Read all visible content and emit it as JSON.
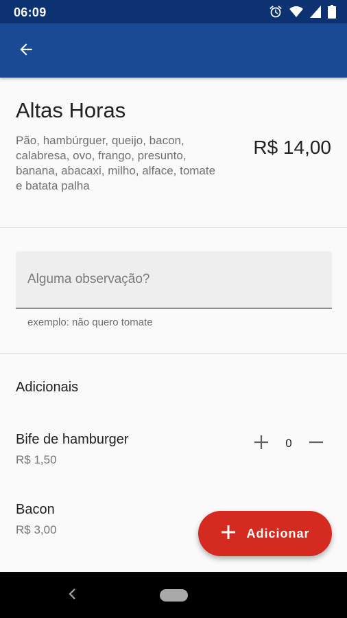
{
  "status_bar": {
    "time": "06:09",
    "icons": [
      "alarm-icon",
      "wifi-icon",
      "signal-icon",
      "battery-icon"
    ]
  },
  "app_bar": {
    "back_icon": "arrow-back-icon",
    "color": "#1a4a94"
  },
  "product": {
    "name": "Altas Horas",
    "description": "Pão, hambúrguer, queijo, bacon, calabresa, ovo, frango, presunto, banana, abacaxi, milho, alface, tomate e batata palha",
    "price": "R$ 14,00"
  },
  "observation": {
    "placeholder": "Alguma observação?",
    "value": "",
    "helper": "exemplo: não quero tomate"
  },
  "addons": {
    "title": "Adicionais",
    "items": [
      {
        "name": "Bife de hamburger",
        "price": "R$ 1,50",
        "quantity": "0"
      },
      {
        "name": "Bacon",
        "price": "R$ 3,00"
      }
    ]
  },
  "fab": {
    "label": "Adicionar",
    "icon": "plus-icon",
    "color": "#d42a20"
  },
  "nav_bar": {
    "icons": [
      "nav-back-icon",
      "nav-home-pill"
    ]
  }
}
